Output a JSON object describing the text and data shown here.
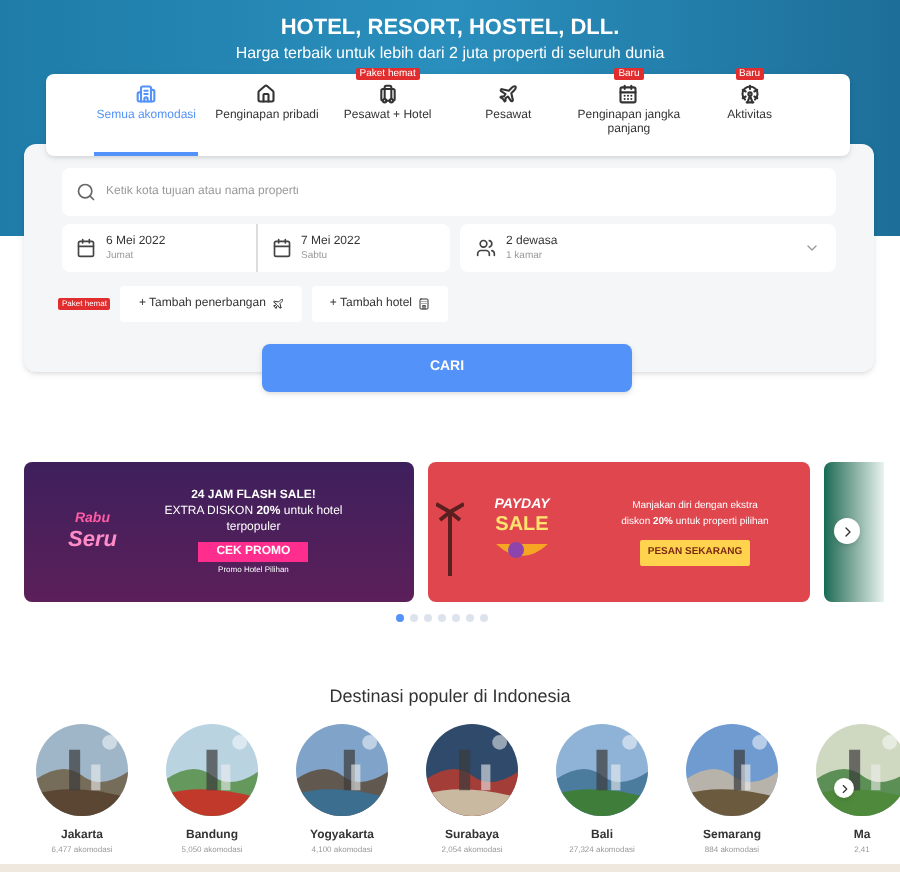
{
  "header": {
    "title": "HOTEL, RESORT, HOSTEL, DLL.",
    "subtitle": "Harga terbaik untuk lebih dari 2 juta properti di seluruh dunia"
  },
  "tabs": [
    {
      "label": "Semua akomodasi",
      "selected": true
    },
    {
      "label": "Penginapan pribadi",
      "selected": false
    },
    {
      "label": "Pesawat + Hotel",
      "selected": false,
      "badge": "Paket hemat"
    },
    {
      "label": "Pesawat",
      "selected": false
    },
    {
      "label": "Penginapan jangka panjang",
      "selected": false,
      "badge": "Baru"
    },
    {
      "label": "Aktivitas",
      "selected": false,
      "badge": "Baru"
    }
  ],
  "search": {
    "placeholder": "Ketik kota tujuan atau nama properti",
    "check_in": {
      "date": "6 Mei 2022",
      "day": "Jumat"
    },
    "check_out": {
      "date": "7 Mei 2022",
      "day": "Sabtu"
    },
    "guests": {
      "adults": "2 dewasa",
      "rooms": "1 kamar"
    },
    "badge": "Paket hemat",
    "add_buttons": [
      "+ Tambah penerbangan",
      "+ Tambah hotel"
    ],
    "submit": "CARI"
  },
  "banners": [
    {
      "brand_top": "Rabu",
      "brand_bottom": "Seru",
      "headline": "24 JAM FLASH SALE!",
      "text": "EXTRA DISKON **20%** untuk hotel terpopuler",
      "button": "CEK PROMO",
      "footnote": "Promo Hotel Pilihan"
    },
    {
      "brand_top": "PAYDAY",
      "brand_bottom": "SALE",
      "text": "Manjakan diri dengan ekstra diskon **20%** untuk properti pilihan",
      "button": "PESAN SEKARANG"
    }
  ],
  "carousel_dots": [
    {
      "selected": true
    },
    {
      "selected": false
    },
    {
      "selected": false
    },
    {
      "selected": false
    },
    {
      "selected": false
    },
    {
      "selected": false
    },
    {
      "selected": false
    }
  ],
  "destinations": {
    "title": "Destinasi populer di Indonesia",
    "items": [
      {
        "name": "Jakarta",
        "count": "6,477 akomodasi"
      },
      {
        "name": "Bandung",
        "count": "5,050 akomodasi"
      },
      {
        "name": "Yogyakarta",
        "count": "4,100 akomodasi"
      },
      {
        "name": "Surabaya",
        "count": "2,054 akomodasi"
      },
      {
        "name": "Bali",
        "count": "27,324 akomodasi"
      },
      {
        "name": "Semarang",
        "count": "884 akomodasi"
      },
      {
        "name": "Ma",
        "count": "2,41"
      }
    ]
  }
}
